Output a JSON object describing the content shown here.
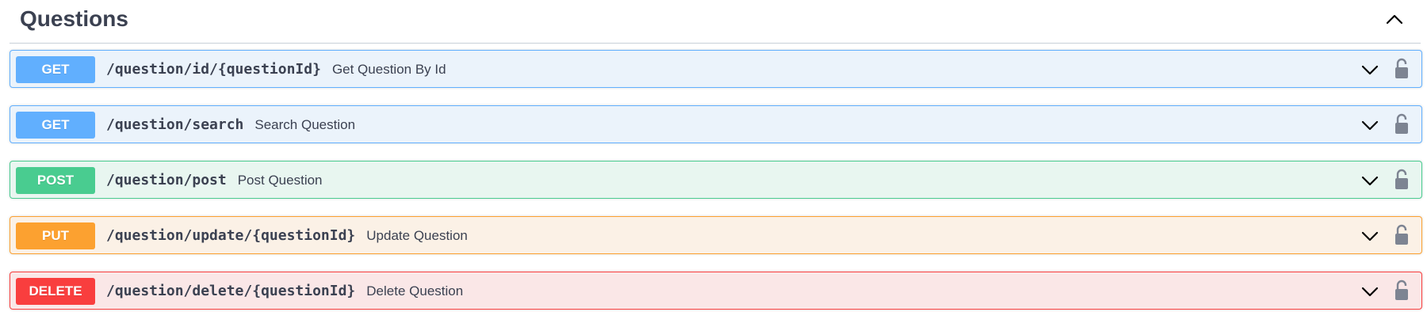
{
  "section": {
    "title": "Questions",
    "toggle_icon": "chevron-up-icon"
  },
  "operations": [
    {
      "method": "GET",
      "path": "/question/id/{questionId}",
      "summary": "Get Question By Id",
      "color": "#61affe"
    },
    {
      "method": "GET",
      "path": "/question/search",
      "summary": "Search Question",
      "color": "#61affe"
    },
    {
      "method": "POST",
      "path": "/question/post",
      "summary": "Post Question",
      "color": "#49cc90"
    },
    {
      "method": "PUT",
      "path": "/question/update/{questionId}",
      "summary": "Update Question",
      "color": "#fca130"
    },
    {
      "method": "DELETE",
      "path": "/question/delete/{questionId}",
      "summary": "Delete Question",
      "color": "#f93e3e"
    }
  ],
  "icons": {
    "expand": "chevron-down-icon",
    "auth": "unlocked-padlock-icon"
  }
}
